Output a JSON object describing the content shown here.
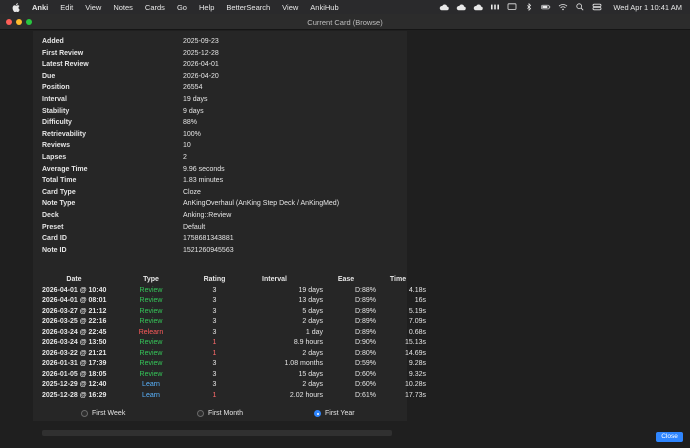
{
  "menubar": {
    "app": "Anki",
    "items": [
      "Edit",
      "View",
      "Notes",
      "Cards",
      "Go",
      "Help",
      "BetterSearch",
      "View",
      "AnkiHub"
    ],
    "clock": "Wed Apr 1  10:41 AM"
  },
  "window": {
    "title": "Current Card (Browse)"
  },
  "info": [
    {
      "label": "Added",
      "value": "2025-09-23"
    },
    {
      "label": "First Review",
      "value": "2025-12-28"
    },
    {
      "label": "Latest Review",
      "value": "2026-04-01"
    },
    {
      "label": "Due",
      "value": "2026-04-20"
    },
    {
      "label": "Position",
      "value": "26554"
    },
    {
      "label": "Interval",
      "value": "19 days"
    },
    {
      "label": "Stability",
      "value": "9 days"
    },
    {
      "label": "Difficulty",
      "value": "88%"
    },
    {
      "label": "Retrievability",
      "value": "100%"
    },
    {
      "label": "Reviews",
      "value": "10"
    },
    {
      "label": "Lapses",
      "value": "2"
    },
    {
      "label": "Average Time",
      "value": "9.96 seconds"
    },
    {
      "label": "Total Time",
      "value": "1.83 minutes"
    },
    {
      "label": "Card Type",
      "value": "Cloze"
    },
    {
      "label": "Note Type",
      "value": "AnKingOverhaul (AnKing Step Deck / AnKingMed)"
    },
    {
      "label": "Deck",
      "value": "Anking::Review"
    },
    {
      "label": "Preset",
      "value": "Default"
    },
    {
      "label": "Card ID",
      "value": "1758681343881"
    },
    {
      "label": "Note ID",
      "value": "1521260945563"
    }
  ],
  "revlog": {
    "headers": {
      "date": "Date",
      "type": "Type",
      "rating": "Rating",
      "interval": "Interval",
      "ease": "Ease",
      "time": "Time"
    },
    "rows": [
      {
        "date": "2026-04-01 @ 10:40",
        "type": "Review",
        "rating": "3",
        "interval": "19 days",
        "ease": "D:88%",
        "time": "4.18s"
      },
      {
        "date": "2026-04-01 @ 08:01",
        "type": "Review",
        "rating": "3",
        "interval": "13 days",
        "ease": "D:89%",
        "time": "16s"
      },
      {
        "date": "2026-03-27 @ 21:12",
        "type": "Review",
        "rating": "3",
        "interval": "5 days",
        "ease": "D:89%",
        "time": "5.19s"
      },
      {
        "date": "2026-03-25 @ 22:16",
        "type": "Review",
        "rating": "3",
        "interval": "2 days",
        "ease": "D:89%",
        "time": "7.09s"
      },
      {
        "date": "2026-03-24 @ 22:45",
        "type": "Relearn",
        "rating": "3",
        "interval": "1 day",
        "ease": "D:89%",
        "time": "0.68s"
      },
      {
        "date": "2026-03-24 @ 13:50",
        "type": "Review",
        "rating": "1",
        "interval": "8.9 hours",
        "ease": "D:90%",
        "time": "15.13s"
      },
      {
        "date": "2026-03-22 @ 21:21",
        "type": "Review",
        "rating": "1",
        "interval": "2 days",
        "ease": "D:80%",
        "time": "14.69s"
      },
      {
        "date": "2026-01-31 @ 17:39",
        "type": "Review",
        "rating": "3",
        "interval": "1.08 months",
        "ease": "D:59%",
        "time": "9.28s"
      },
      {
        "date": "2026-01-05 @ 18:05",
        "type": "Review",
        "rating": "3",
        "interval": "15 days",
        "ease": "D:60%",
        "time": "9.32s"
      },
      {
        "date": "2025-12-29 @ 12:40",
        "type": "Learn",
        "rating": "3",
        "interval": "2 days",
        "ease": "D:60%",
        "time": "10.28s"
      },
      {
        "date": "2025-12-28 @ 16:29",
        "type": "Learn",
        "rating": "1",
        "interval": "2.02 hours",
        "ease": "D:61%",
        "time": "17.73s"
      }
    ]
  },
  "range_options": [
    {
      "label": "First Week",
      "selected": false
    },
    {
      "label": "First Month",
      "selected": false
    },
    {
      "label": "First Year",
      "selected": true
    }
  ],
  "buttons": {
    "close": "Close"
  },
  "colors": {
    "review": "#35c759",
    "relearn": "#ff5b5b",
    "learn": "#5ab4ff",
    "accent": "#2f86ff"
  }
}
